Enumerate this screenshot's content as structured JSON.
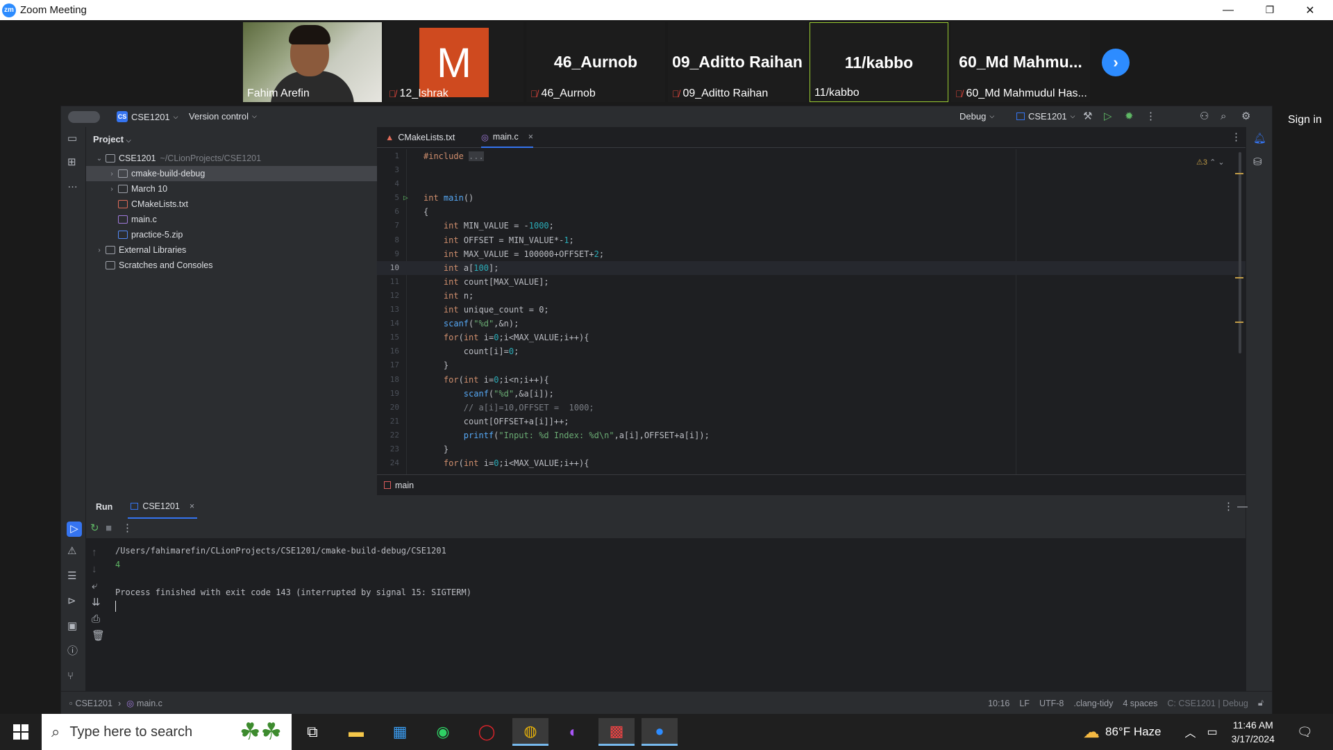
{
  "window": {
    "title": "Zoom Meeting",
    "app_icon": "zoom-logo",
    "minimize": "—",
    "restore": "❐",
    "close": "✕"
  },
  "participants": [
    {
      "name": "",
      "label": "Fahim Arefin",
      "muted": false,
      "kind": "video"
    },
    {
      "name": "M",
      "label": "12_Ishrak",
      "muted": true,
      "kind": "avatar",
      "color": "#cf4a1f"
    },
    {
      "name": "46_Aurnob",
      "label": "46_Aurnob",
      "muted": true,
      "kind": "name"
    },
    {
      "name": "09_Aditto Raihan",
      "label": "09_Aditto Raihan",
      "muted": true,
      "kind": "name"
    },
    {
      "name": "11/kabbo",
      "label": "11/kabbo",
      "muted": false,
      "kind": "name",
      "active_speaker": true
    },
    {
      "name": "60_Md  Mahmu...",
      "label": "60_Md Mahmudul Has...",
      "muted": true,
      "kind": "name"
    }
  ],
  "next_page_icon": "chevron-right-icon",
  "sign_in": "Sign in",
  "ide": {
    "project_badge": "CS",
    "project_name": "CSE1201",
    "vcs": "Version control",
    "run_config": "Debug",
    "target": "CSE1201",
    "sidebar_title": "Project",
    "tree": [
      {
        "name": "CSE1201",
        "hint": "~/CLionProjects/CSE1201",
        "depth": 0,
        "arrow": "⌄",
        "icon": "folder"
      },
      {
        "name": "cmake-build-debug",
        "hint": "",
        "depth": 1,
        "arrow": "›",
        "icon": "folder",
        "selected": true
      },
      {
        "name": "March 10",
        "hint": "",
        "depth": 1,
        "arrow": "›",
        "icon": "folder"
      },
      {
        "name": "CMakeLists.txt",
        "hint": "",
        "depth": 1,
        "arrow": "",
        "icon": "cmake"
      },
      {
        "name": "main.c",
        "hint": "",
        "depth": 1,
        "arrow": "",
        "icon": "c-file"
      },
      {
        "name": "practice-5.zip",
        "hint": "",
        "depth": 1,
        "arrow": "",
        "icon": "zip"
      },
      {
        "name": "External Libraries",
        "hint": "",
        "depth": 0,
        "arrow": "›",
        "icon": "library"
      },
      {
        "name": "Scratches and Consoles",
        "hint": "",
        "depth": 0,
        "arrow": "",
        "icon": "scratch"
      }
    ],
    "tabs": [
      {
        "label": "CMakeLists.txt",
        "active": false
      },
      {
        "label": "main.c",
        "active": true,
        "close": "×"
      }
    ],
    "warnings": "3",
    "current_line": 10,
    "code": [
      {
        "n": "1",
        "t": "#include ..."
      },
      {
        "n": "3",
        "t": ""
      },
      {
        "n": "4",
        "t": ""
      },
      {
        "n": "5",
        "t": "int main()"
      },
      {
        "n": "6",
        "t": "{"
      },
      {
        "n": "7",
        "t": "    int MIN_VALUE = -1000;"
      },
      {
        "n": "8",
        "t": "    int OFFSET = MIN_VALUE*-1;"
      },
      {
        "n": "9",
        "t": "    int MAX_VALUE = 100000+OFFSET+2;"
      },
      {
        "n": "10",
        "t": "    int a[100];"
      },
      {
        "n": "11",
        "t": "    int count[MAX_VALUE];"
      },
      {
        "n": "12",
        "t": "    int n;"
      },
      {
        "n": "13",
        "t": "    int unique_count = 0;"
      },
      {
        "n": "14",
        "t": "    scanf(\"%d\",&n);"
      },
      {
        "n": "15",
        "t": "    for(int i=0;i<MAX_VALUE;i++){"
      },
      {
        "n": "16",
        "t": "        count[i]=0;"
      },
      {
        "n": "17",
        "t": "    }"
      },
      {
        "n": "18",
        "t": "    for(int i=0;i<n;i++){"
      },
      {
        "n": "19",
        "t": "        scanf(\"%d\",&a[i]);"
      },
      {
        "n": "20",
        "t": "        // a[i]=10,OFFSET =  1000;"
      },
      {
        "n": "21",
        "t": "        count[OFFSET+a[i]]++;"
      },
      {
        "n": "22",
        "t": "        printf(\"Input: %d Index: %d\\n\",a[i],OFFSET+a[i]);"
      },
      {
        "n": "23",
        "t": "    }"
      },
      {
        "n": "24",
        "t": "    for(int i=0;i<MAX_VALUE;i++){"
      }
    ],
    "breadcrumb": "main",
    "run": {
      "label": "Run",
      "tab": "CSE1201",
      "output": [
        "/Users/fahimarefin/CLionProjects/CSE1201/cmake-build-debug/CSE1201",
        "4",
        "",
        "Process finished with exit code 143 (interrupted by signal 15: SIGTERM)"
      ]
    },
    "status": {
      "path_project": "CSE1201",
      "path_file": "main.c",
      "position": "10:16",
      "line_sep": "LF",
      "encoding": "UTF-8",
      "linter": ".clang-tidy",
      "indent": "4 spaces",
      "context": "C: CSE1201 | Debug"
    }
  },
  "taskbar": {
    "search_placeholder": "Type here to search",
    "weather": "86°F  Haze",
    "time": "11:46 AM",
    "date": "3/17/2024",
    "apps": [
      "task-view-icon",
      "file-explorer-icon",
      "store-icon",
      "whatsapp-icon",
      "opera-icon",
      "chrome-icon",
      "messenger-icon",
      "office-icon",
      "zoom-icon"
    ]
  }
}
